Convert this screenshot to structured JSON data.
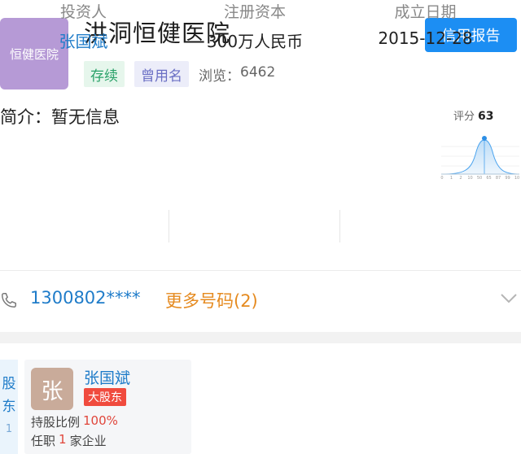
{
  "company": {
    "logo_text": "恒健医院",
    "name": "洪洞恒健医院",
    "tags": {
      "status": "存续",
      "former_name": "曾用名"
    },
    "views_label": "浏览：",
    "views_count": "6462",
    "report_button": "信用报告",
    "intro_label": "简介：",
    "intro_value": "暂无信息"
  },
  "score": {
    "label": "评分",
    "value": "63",
    "ticks": [
      "0",
      "1",
      "2",
      "10",
      "50",
      "65",
      "87",
      "99",
      "10"
    ]
  },
  "stats": [
    {
      "label": "投资人",
      "value": "张国斌"
    },
    {
      "label": "注册资本",
      "value": "300万人民币"
    },
    {
      "label": "成立日期",
      "value": "2015-12-28"
    }
  ],
  "contact": {
    "phone": "1300802****",
    "more_numbers": "更多号码(2)"
  },
  "shareholders": {
    "side_tab": [
      "股",
      "东",
      "1"
    ],
    "items": [
      {
        "avatar_char": "张",
        "name": "张国斌",
        "badge": "大股东",
        "ratio_label": "持股比例",
        "ratio_value": "100%",
        "positions_prefix": "任职",
        "positions_count": "1",
        "positions_suffix": "家企业"
      }
    ]
  },
  "colors": {
    "primary": "#1c8ef3",
    "link": "#1f7cc9",
    "orange": "#e58a1f",
    "green": "#2ba26a",
    "red": "#f04b3e",
    "logo_bg": "#b69ad6"
  }
}
